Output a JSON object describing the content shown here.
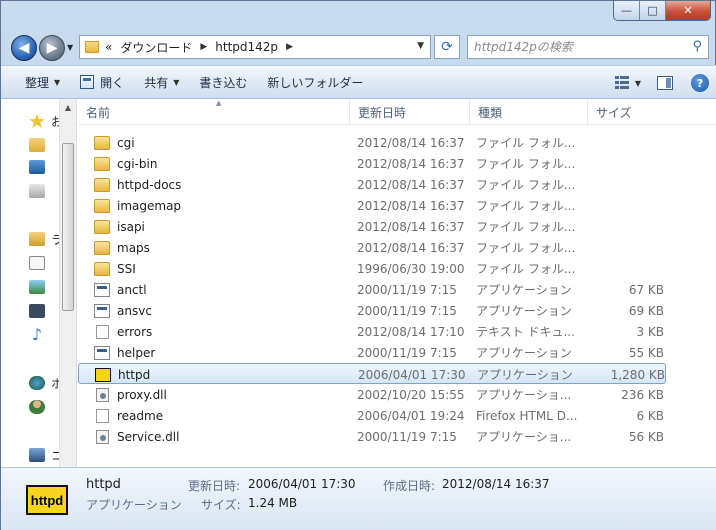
{
  "window": {
    "controls": {
      "minimize": "—",
      "maximize": "□",
      "close": "✕"
    }
  },
  "address": {
    "more": "«",
    "crumbs": [
      "ダウンロード",
      "httpd142p"
    ]
  },
  "search": {
    "placeholder": "httpd142pの検索"
  },
  "toolbar": {
    "organize": "整理",
    "open": "開く",
    "share": "共有",
    "burn": "書き込む",
    "new_folder": "新しいフォルダー"
  },
  "navpane": {
    "items": [
      {
        "label": "お",
        "icon": "star-icon"
      },
      {
        "label": "",
        "icon": "downloads-icon"
      },
      {
        "label": "",
        "icon": "desktop-icon"
      },
      {
        "label": "",
        "icon": "recent-places-icon"
      },
      {
        "label": "ラ",
        "icon": "libraries-icon"
      },
      {
        "label": "",
        "icon": "documents-icon"
      },
      {
        "label": "",
        "icon": "pictures-icon"
      },
      {
        "label": "",
        "icon": "videos-icon"
      },
      {
        "label": "",
        "icon": "music-icon"
      },
      {
        "label": "ホ",
        "icon": "homegroup-icon"
      },
      {
        "label": "",
        "icon": "user-icon"
      },
      {
        "label": "コ",
        "icon": "computer-icon"
      }
    ]
  },
  "columns": {
    "name": "名前",
    "date": "更新日時",
    "type": "種類",
    "size": "サイズ"
  },
  "files": [
    {
      "name": "cgi",
      "date": "2012/08/14 16:37",
      "type": "ファイル フォル...",
      "size": "",
      "icon": "folder"
    },
    {
      "name": "cgi-bin",
      "date": "2012/08/14 16:37",
      "type": "ファイル フォル...",
      "size": "",
      "icon": "folder"
    },
    {
      "name": "httpd-docs",
      "date": "2012/08/14 16:37",
      "type": "ファイル フォル...",
      "size": "",
      "icon": "folder"
    },
    {
      "name": "imagemap",
      "date": "2012/08/14 16:37",
      "type": "ファイル フォル...",
      "size": "",
      "icon": "folder"
    },
    {
      "name": "isapi",
      "date": "2012/08/14 16:37",
      "type": "ファイル フォル...",
      "size": "",
      "icon": "folder"
    },
    {
      "name": "maps",
      "date": "2012/08/14 16:37",
      "type": "ファイル フォル...",
      "size": "",
      "icon": "folder"
    },
    {
      "name": "SSI",
      "date": "1996/06/30 19:00",
      "type": "ファイル フォル...",
      "size": "",
      "icon": "folder"
    },
    {
      "name": "anctl",
      "date": "2000/11/19 7:15",
      "type": "アプリケーション",
      "size": "67 KB",
      "icon": "exe"
    },
    {
      "name": "ansvc",
      "date": "2000/11/19 7:15",
      "type": "アプリケーション",
      "size": "69 KB",
      "icon": "exe"
    },
    {
      "name": "errors",
      "date": "2012/08/14 17:10",
      "type": "テキスト ドキュ...",
      "size": "3 KB",
      "icon": "txt"
    },
    {
      "name": "helper",
      "date": "2000/11/19 7:15",
      "type": "アプリケーション",
      "size": "55 KB",
      "icon": "exe"
    },
    {
      "name": "httpd",
      "date": "2006/04/01 17:30",
      "type": "アプリケーション",
      "size": "1,280 KB",
      "icon": "httpd",
      "selected": true
    },
    {
      "name": "proxy.dll",
      "date": "2002/10/20 15:55",
      "type": "アプリケーショ...",
      "size": "236 KB",
      "icon": "dll"
    },
    {
      "name": "readme",
      "date": "2006/04/01 19:24",
      "type": "Firefox HTML D...",
      "size": "6 KB",
      "icon": "txt"
    },
    {
      "name": "Service.dll",
      "date": "2000/11/19 7:15",
      "type": "アプリケーショ...",
      "size": "56 KB",
      "icon": "dll"
    }
  ],
  "details": {
    "name": "httpd",
    "type": "アプリケーション",
    "modified_label": "更新日時:",
    "modified_value": "2006/04/01 17:30",
    "created_label": "作成日時:",
    "created_value": "2012/08/14 16:37",
    "size_label": "サイズ:",
    "size_value": "1.24 MB",
    "icon_text": "httpd"
  }
}
